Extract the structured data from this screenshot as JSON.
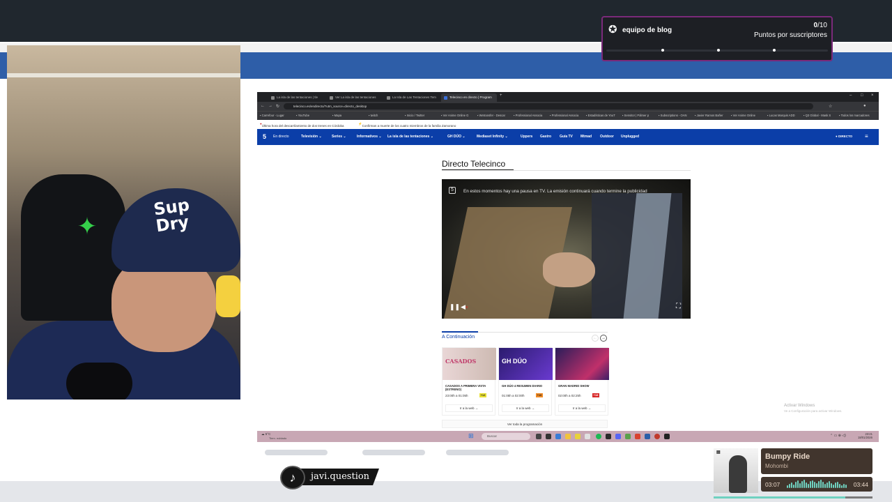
{
  "goal_widget": {
    "name": "equipo de blog",
    "current": "0",
    "target": "/10",
    "subtitle": "Puntos por suscriptores"
  },
  "browser": {
    "tabs": [
      {
        "label": "La isla de las tentaciones | tle"
      },
      {
        "label": "Ver La isla de las tentaciones"
      },
      {
        "label": "La Isla de Las Tentaciones Tem"
      },
      {
        "label": "Telecinco en directo | Program"
      }
    ],
    "url": "telecinco.es/endirecto/?utm_source=directo_desktop",
    "bookmarks": [
      "Carrefour - Lugar",
      "YouTube",
      "Mapa",
      "twitch",
      "Inicio / Twitter",
      "Ver Anime Online G",
      "Wetransfer - Descar",
      "Professional Associa",
      "Professional Associa",
      "Estadísticas de YouT",
      "Sensitor | Pálmer p",
      "Subscriptions - OAN",
      "Javier Ramos Bañer",
      "Ver Anime Online",
      "Lucas Marquis ADD",
      "Q3 Global - Mask S",
      "Todos los marcadores"
    ],
    "ticker": [
      {
        "text": "Última hora del descarrilamiento de dos trenes en Córdoba"
      },
      {
        "text": "Confirman a muerte de los cuatro miembros de la familia Zamorano"
      }
    ]
  },
  "site": {
    "logo": "5",
    "nav": [
      "En directo",
      "Televisión ⌄",
      "Series ⌄",
      "Informativos ⌄",
      "La isla de las tentaciones ⌄",
      "GH DÚO ⌄",
      "Mediaset Infinity ⌄",
      "Uppers",
      "Gastro",
      "Guía TV",
      "Mtmad",
      "Outdoor",
      "Unplugged"
    ],
    "live_label": "● DIRECTO",
    "page_title": "Directo Telecinco",
    "player_message": "En estos momentos hay una pausa en TV. La emisión continuará cuando termine la publicidad",
    "next_heading": "A Continuación",
    "cards": [
      {
        "thumb": "CASADOS",
        "title": "CASADOS A PRIMERA VISTA (ESTRENO)",
        "time": "23:00h a 01:05h",
        "rating": "+12",
        "button": "Ir a la web →"
      },
      {
        "thumb": "GH DÚO",
        "title": "GH DÚO 4 RESUMEN DIARIO",
        "time": "01:05h a 02:00h",
        "rating": "+16",
        "button": "Ir a la web →"
      },
      {
        "thumb": "",
        "title": "GRAN MADRID SHOW",
        "time": "02:00h a 02:25h",
        "rating": "+18",
        "button": "Ir a la web →"
      }
    ],
    "all_schedule": "Ver toda la programación",
    "activate_windows": "Activar Windows",
    "activate_windows_sub": "Ve a Configuración para activar Windows."
  },
  "taskbar": {
    "weather_temp": "5°C",
    "weather_desc": "Tiem. nublado",
    "search": "Buscar",
    "time": "23:21",
    "date": "18/01/2026"
  },
  "music": {
    "title": "Bumpy Ride",
    "artist": "Mohombi",
    "elapsed": "03:07",
    "total": "03:44",
    "progress": 0.83
  },
  "tiktok": {
    "handle": "javi.question"
  },
  "colors": {
    "site_blue": "#0b3ea8",
    "music_panel": "#41352d",
    "music_accent": "#6fd1c0",
    "goal_border": "#7b2a7b"
  }
}
